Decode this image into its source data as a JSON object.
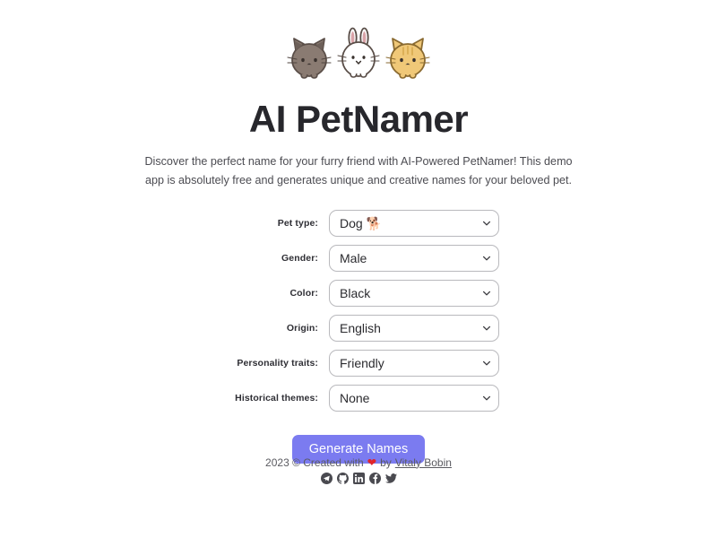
{
  "app": {
    "title": "AI PetNamer",
    "description": "Discover the perfect name for your furry friend with AI-Powered PetNamer! This demo app is absolutely free and generates unique and creative names for your beloved pet.",
    "hero_art": [
      "gray-cat",
      "white-rabbit",
      "orange-cat"
    ]
  },
  "form": {
    "fields": [
      {
        "label": "Pet type:",
        "value": "Dog 🐕",
        "name": "pet-type"
      },
      {
        "label": "Gender:",
        "value": "Male",
        "name": "gender"
      },
      {
        "label": "Color:",
        "value": "Black",
        "name": "color"
      },
      {
        "label": "Origin:",
        "value": "English",
        "name": "origin"
      },
      {
        "label": "Personality traits:",
        "value": "Friendly",
        "name": "personality-traits"
      },
      {
        "label": "Historical themes:",
        "value": "None",
        "name": "historical-themes"
      }
    ],
    "submit_label": "Generate Names"
  },
  "footer": {
    "credit_prefix": "2023 © Created with",
    "heart": "❤",
    "credit_middle": "by",
    "author": "Vitaly Bobin",
    "social": [
      {
        "name": "telegram-icon"
      },
      {
        "name": "github-icon"
      },
      {
        "name": "linkedin-icon"
      },
      {
        "name": "facebook-icon"
      },
      {
        "name": "twitter-icon"
      }
    ]
  },
  "colors": {
    "accent": "#7b7bf0",
    "heart": "#e0242a",
    "text": "#2b2b2f",
    "muted": "#5b5b61",
    "border": "#b9b9bd"
  }
}
